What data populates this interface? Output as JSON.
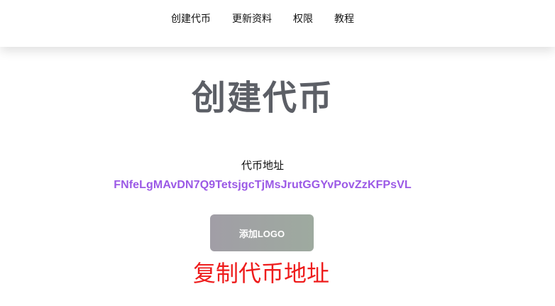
{
  "nav": {
    "items": [
      {
        "label": "创建代币"
      },
      {
        "label": "更新资料"
      },
      {
        "label": "权限"
      },
      {
        "label": "教程"
      }
    ]
  },
  "main": {
    "title": "创建代币",
    "address_label": "代币地址",
    "address_value": "FNfeLgMAvDN7Q9TetsjgcTjMsJrutGGYvPovZzKFPsVL",
    "add_logo_label": "添加LOGO",
    "copy_label": "复制代币地址"
  },
  "colors": {
    "title": "#5c5f66",
    "address": "#9b59e6",
    "copy": "#ee1c1c",
    "button_gradient_start": "#a19ea6",
    "button_gradient_end": "#9eaa9f"
  }
}
